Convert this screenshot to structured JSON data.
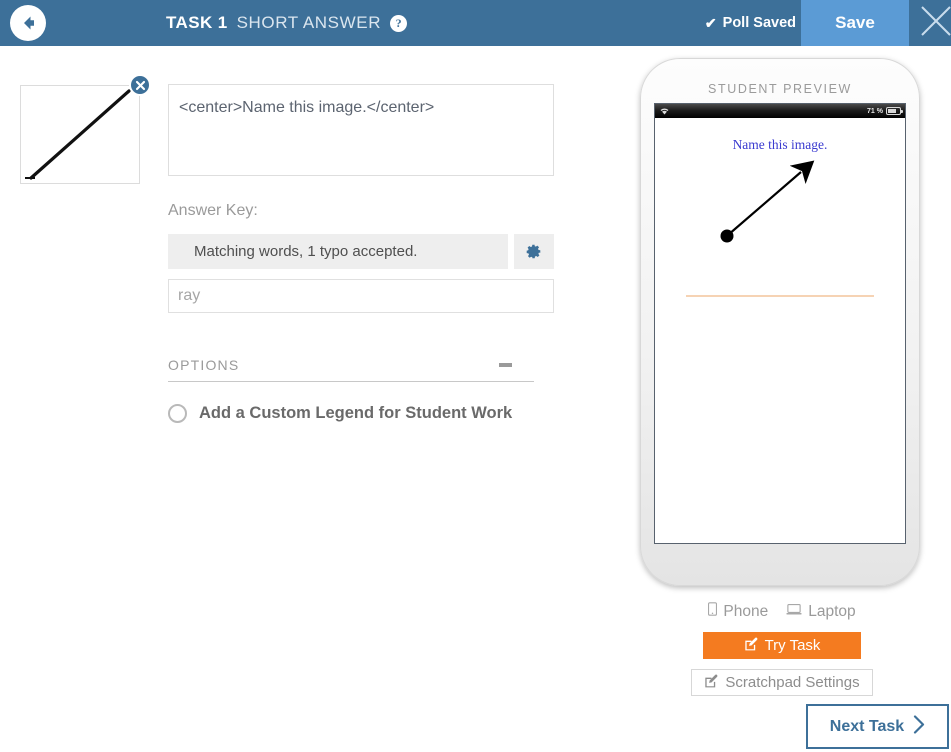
{
  "header": {
    "back_icon": "back-arrow-icon",
    "task_number": "TASK 1",
    "task_type": "SHORT ANSWER",
    "help_icon": "?",
    "poll_status": "Poll Saved",
    "poll_check": "✔",
    "save_label": "Save",
    "close_icon": "close-icon",
    "bg_color": "#3d7099",
    "save_bg_color": "#5b9bd5"
  },
  "thumbnail": {
    "alt": "ray-diagram-thumbnail",
    "delete_icon": "✕"
  },
  "editor": {
    "prompt_text": "<center>Name this image.</center>",
    "answer_key_label": "Answer Key:",
    "match_rule": "Matching words, 1 typo accepted.",
    "gear_icon": "gear-icon",
    "answer_value": "ray",
    "answer_placeholder": "ray",
    "options_title": "OPTIONS",
    "collapse_icon": "minus-icon",
    "legend_option_label": "Add a Custom Legend for Student Work"
  },
  "preview": {
    "caption": "STUDENT PREVIEW",
    "status_battery": "71 %",
    "battery_percent": 71,
    "wifi_icon": "wifi-icon",
    "screen_title": "Name this image.",
    "answer_line_color": "#f6d3b4",
    "title_color": "#3b3bd0"
  },
  "device": {
    "phone_label": "Phone",
    "phone_icon": "phone-icon",
    "laptop_label": "Laptop",
    "laptop_icon": "laptop-icon"
  },
  "actions": {
    "try_task_label": "Try Task",
    "try_task_icon": "pencil-square-icon",
    "try_task_color": "#f47b20",
    "scratchpad_label": "Scratchpad Settings",
    "scratchpad_icon": "pencil-square-icon",
    "next_task_label": "Next Task",
    "next_task_icon": "chevron-right-icon"
  }
}
